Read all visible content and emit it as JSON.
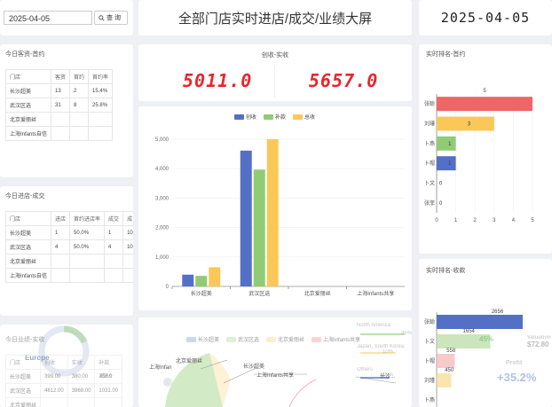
{
  "header": {
    "date_value": "2025-04-05",
    "search_label": "查 询",
    "title": "全部门店实时进店/成交/业绩大屏",
    "digital_date": "2025-04-05"
  },
  "appointments": {
    "title": "今日客资-首约",
    "columns": [
      "门店",
      "客资",
      "首约",
      "首约率"
    ],
    "rows": [
      [
        "长沙超美",
        "13",
        "2",
        "15.4%"
      ],
      [
        "武汉区选",
        "31",
        "8",
        "25.8%"
      ],
      [
        "北京爱丽丝",
        "",
        "",
        ""
      ],
      [
        "上海Infants自信",
        "",
        "",
        ""
      ]
    ]
  },
  "visits": {
    "title": "今日进店-成交",
    "columns": [
      "门店",
      "进店",
      "首约进店率",
      "成交",
      "成"
    ],
    "rows": [
      [
        "长沙超美",
        "1",
        "50.0%",
        "1",
        "10"
      ],
      [
        "武汉区选",
        "4",
        "50.0%",
        "4",
        "10"
      ],
      [
        "北京爱丽丝",
        "",
        "",
        "",
        ""
      ],
      [
        "上海Infants自信",
        "",
        "",
        "",
        ""
      ]
    ]
  },
  "performance": {
    "title": "今日业绩-实收",
    "columns": [
      "门店",
      "创收",
      "实收",
      "补款"
    ],
    "rows": [
      [
        "长沙超美",
        "399.00",
        "380.00",
        "358.0"
      ],
      [
        "武汉区选",
        "4612.00",
        "3968.00",
        "1031.00"
      ],
      [
        "北京爱丽丝",
        "",
        "",
        ""
      ]
    ],
    "ghost_labels": [
      "Europe",
      "45%"
    ]
  },
  "revenue": {
    "title": "创收-实收",
    "created": "5011.0",
    "received": "5657.0"
  },
  "bar_chart": {
    "legend": [
      "创收",
      "补款",
      "总收"
    ],
    "y_ticks": [
      "0",
      "1,000",
      "2,000",
      "3,000",
      "4,000",
      "5,000"
    ]
  },
  "bottom_overlay": {
    "legend": [
      "长沙超美",
      "武汉区选",
      "北京爱丽丝",
      "上海Infants共享"
    ],
    "labels": [
      "北京爱丽丝",
      "上海Infan",
      "长沙超美",
      "上海Infants共享",
      "长沙..."
    ],
    "ghost_text": [
      "North America",
      "35%",
      "Japan, South Korea",
      "10%",
      "Others",
      "10%"
    ]
  },
  "rank_appointments": {
    "title": "实时排名-首约",
    "y_labels": [
      "张聪",
      "刘瑾",
      "卜燕",
      "卜帽",
      "卜文",
      "张菲"
    ],
    "values": [
      5,
      3,
      1,
      1,
      0,
      0
    ],
    "x_ticks": [
      "0",
      "1",
      "2",
      "3",
      "4",
      "5"
    ],
    "top_label": "5"
  },
  "rank_revenue": {
    "title": "实时排名-收款",
    "y_labels": [
      "张聪",
      "卜文",
      "卜帽",
      "刘瑾",
      "卜燕"
    ],
    "values": [
      2656,
      1654,
      558,
      450,
      0
    ],
    "labels": [
      "2656",
      "1654",
      "558",
      "450"
    ],
    "ghost_text": [
      "45%",
      "Valuation",
      "$72.80",
      "Profit",
      "+35.2%"
    ]
  },
  "colors": {
    "blue": "#5470c6",
    "green": "#91cc75",
    "yellow": "#fac858",
    "red": "#ee6666",
    "led": "#e8262b"
  },
  "chart_data": [
    {
      "type": "bar",
      "title": "",
      "categories": [
        "长沙超美",
        "武汉区选",
        "北京爱丽丝",
        "上海Infants共享"
      ],
      "series": [
        {
          "name": "创收",
          "values": [
            399,
            4612,
            0,
            0
          ]
        },
        {
          "name": "补款",
          "values": [
            358,
            3968,
            0,
            0
          ]
        },
        {
          "name": "总收",
          "values": [
            650,
            5000,
            0,
            0
          ]
        }
      ],
      "ylim": [
        0,
        5000
      ],
      "legend": "top-center",
      "grid": true
    },
    {
      "type": "bar",
      "title": "实时排名-首约",
      "categories": [
        "张聪",
        "刘瑾",
        "卜燕",
        "卜帽",
        "卜文",
        "张菲"
      ],
      "values": [
        5,
        3,
        1,
        1,
        0,
        0
      ],
      "xlim": [
        0,
        5
      ]
    },
    {
      "type": "bar",
      "title": "实时排名-收款",
      "categories": [
        "张聪",
        "卜文",
        "卜帽",
        "刘瑾",
        "卜燕"
      ],
      "values": [
        2656,
        1654,
        558,
        450,
        0
      ]
    }
  ]
}
